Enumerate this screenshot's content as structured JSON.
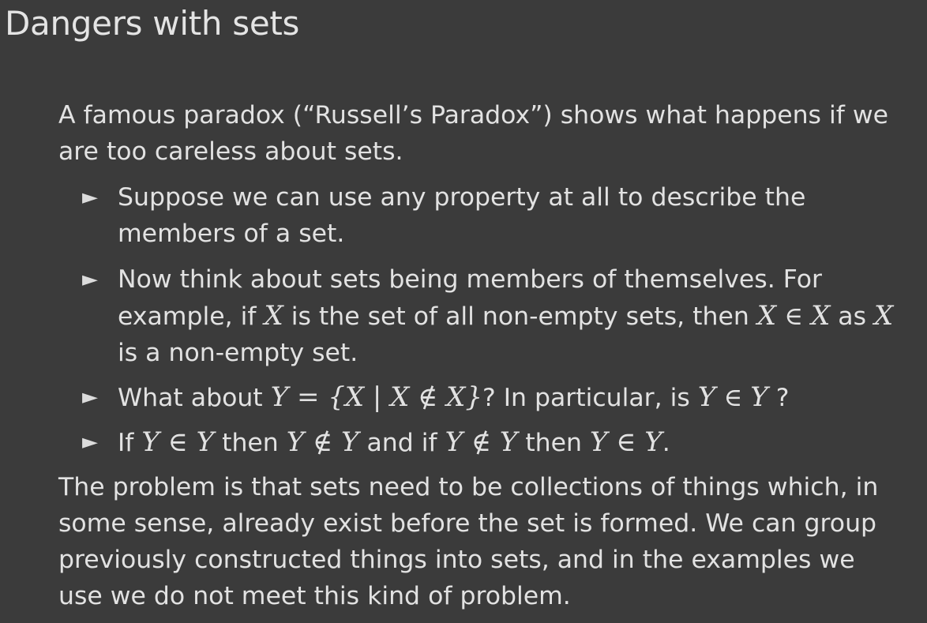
{
  "slide": {
    "title": "Dangers with sets",
    "intro": "A famous paradox (“Russell’s Paradox”) shows what happens if we are too careless about sets.",
    "bullet_marker": "►",
    "bullets": [
      {
        "text": "Suppose we can use any property at all to describe the members of a set."
      },
      {
        "part1": "Now think about sets being members of themselves. For example, if ",
        "var_a": "X",
        "part2": " is the set of all non-empty sets, then ",
        "var_b": "X",
        "rel": " ∈ ",
        "var_c": "X",
        "part3": " as ",
        "var_d": "X",
        "part4": " is a non-empty set."
      },
      {
        "part1": "What about ",
        "math1": "Y = {X | X ∉ X}",
        "part2": "? In particular, is ",
        "var_a": "Y",
        "rel": " ∈ ",
        "var_b": "Y",
        "part3": " ?"
      },
      {
        "part1": "If ",
        "math1": "Y ∈ Y",
        "part2": " then ",
        "math2": "Y ∉ Y",
        "part3": " and if ",
        "math3": "Y ∉ Y",
        "part4": " then ",
        "math4": "Y ∈ Y",
        "part5": "."
      }
    ],
    "conclusion": "The problem is that sets need to be collections of things which, in some sense, already exist before the set is formed. We can group previously constructed things into sets, and in the examples we use we do not meet this kind of problem."
  }
}
